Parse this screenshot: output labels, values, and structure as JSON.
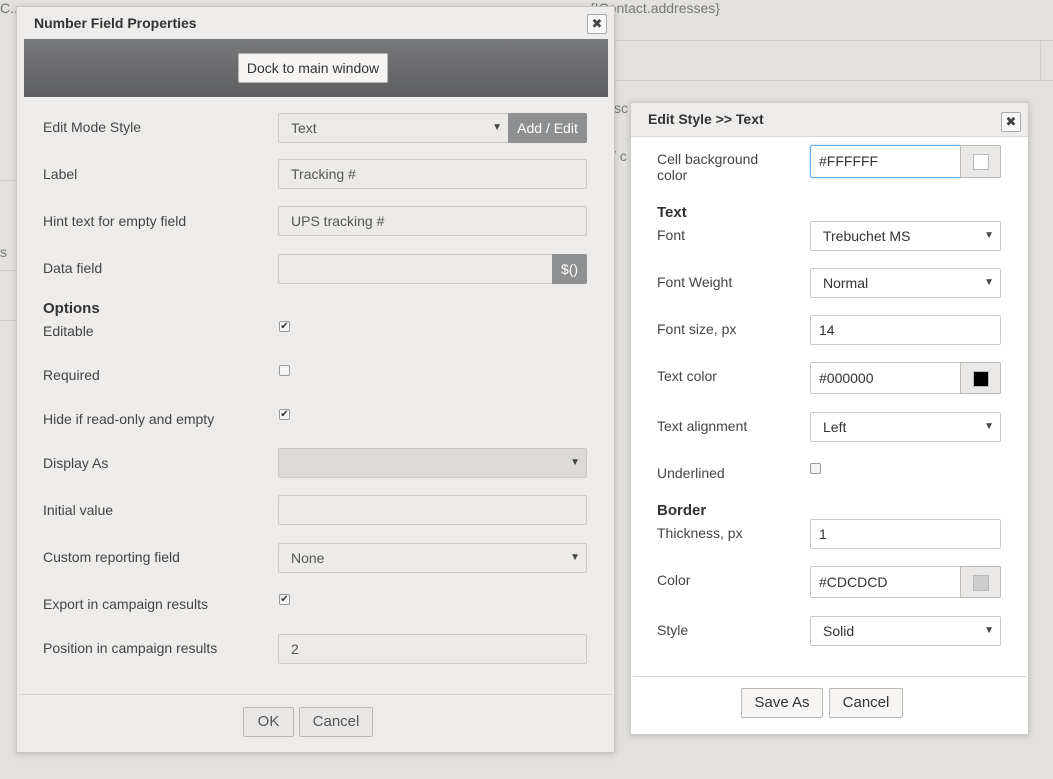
{
  "background": {
    "fragment_top_left": "C...",
    "fragment_top": "{!Contact.addresses}",
    "fragment_mid1": "sc",
    "fragment_mid2": "/ c",
    "fragment_left": "s"
  },
  "left_dialog": {
    "title": "Number Field Properties",
    "close_symbol": "✖",
    "dock_button": "Dock to main window",
    "fields": {
      "edit_mode_style": {
        "label": "Edit Mode Style",
        "value": "Text",
        "addon": "Add / Edit"
      },
      "label": {
        "label": "Label",
        "value": "Tracking #"
      },
      "hint": {
        "label": "Hint text for empty field",
        "value": "UPS tracking #"
      },
      "data_field": {
        "label": "Data field",
        "value": "",
        "addon": "$()"
      }
    },
    "options_heading": "Options",
    "options": {
      "editable": {
        "label": "Editable",
        "checked": true
      },
      "required": {
        "label": "Required",
        "checked": false
      },
      "hide_if_empty": {
        "label": "Hide if read-only and empty",
        "checked": true
      },
      "display_as": {
        "label": "Display As",
        "value": ""
      },
      "initial_value": {
        "label": "Initial value",
        "value": ""
      },
      "custom_reporting": {
        "label": "Custom reporting field",
        "value": "None"
      },
      "export": {
        "label": "Export in campaign results",
        "checked": true
      },
      "position": {
        "label": "Position in campaign results",
        "value": "2"
      }
    },
    "ok_button": "OK",
    "cancel_button": "Cancel",
    "check_mark": "✔",
    "arrow": "▼"
  },
  "right_dialog": {
    "title": "Edit Style >> Text",
    "close_symbol": "✖",
    "cell_bg": {
      "label": "Cell background color",
      "value": "#FFFFFF",
      "swatch": "#FFFFFF"
    },
    "text_heading": "Text",
    "font": {
      "label": "Font",
      "value": "Trebuchet MS"
    },
    "font_weight": {
      "label": "Font Weight",
      "value": "Normal"
    },
    "font_size": {
      "label": "Font size, px",
      "value": "14"
    },
    "text_color": {
      "label": "Text color",
      "value": "#000000",
      "swatch": "#000000"
    },
    "text_align": {
      "label": "Text alignment",
      "value": "Left"
    },
    "underlined": {
      "label": "Underlined",
      "checked": false
    },
    "border_heading": "Border",
    "thickness": {
      "label": "Thickness, px",
      "value": "1"
    },
    "border_color": {
      "label": "Color",
      "value": "#CDCDCD",
      "swatch": "#CDCDCD"
    },
    "border_style": {
      "label": "Style",
      "value": "Solid"
    },
    "save_as_button": "Save As",
    "cancel_button": "Cancel",
    "arrow": "▼"
  }
}
